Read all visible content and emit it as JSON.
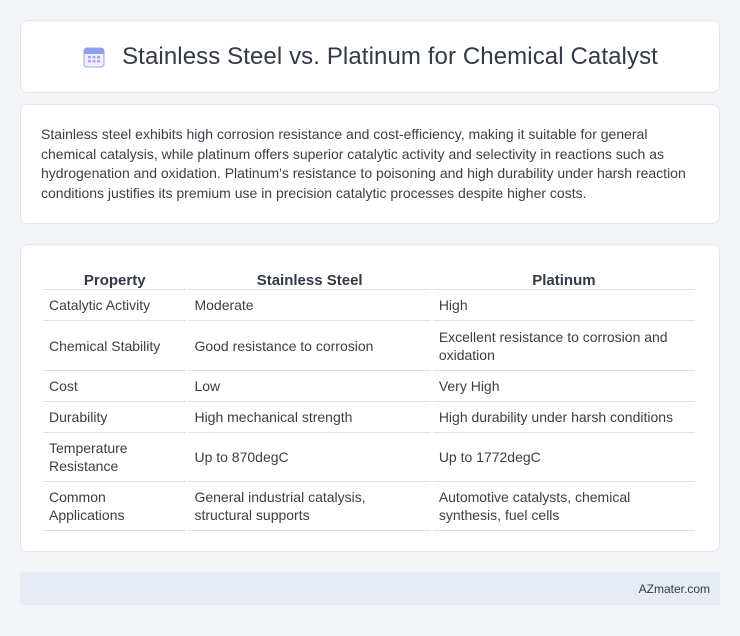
{
  "header": {
    "title": "Stainless Steel vs. Platinum for Chemical Catalyst",
    "icon": "calendar-icon"
  },
  "summary": {
    "text": "Stainless steel exhibits high corrosion resistance and cost-efficiency, making it suitable for general chemical catalysis, while platinum offers superior catalytic activity and selectivity in reactions such as hydrogenation and oxidation. Platinum's resistance to poisoning and high durability under harsh reaction conditions justifies its premium use in precision catalytic processes despite higher costs."
  },
  "table": {
    "headers": [
      "Property",
      "Stainless Steel",
      "Platinum"
    ],
    "rows": [
      [
        "Catalytic Activity",
        "Moderate",
        "High"
      ],
      [
        "Chemical Stability",
        "Good resistance to corrosion",
        "Excellent resistance to corrosion and oxidation"
      ],
      [
        "Cost",
        "Low",
        "Very High"
      ],
      [
        "Durability",
        "High mechanical strength",
        "High durability under harsh conditions"
      ],
      [
        "Temperature Resistance",
        "Up to 870degC",
        "Up to 1772degC"
      ],
      [
        "Common Applications",
        "General industrial catalysis, structural supports",
        "Automotive catalysts, chemical synthesis, fuel cells"
      ]
    ]
  },
  "footer": {
    "text": "AZmater.com"
  },
  "colors": {
    "background": "#f3f5f9",
    "card": "#ffffff",
    "footer": "#e6ebf5",
    "icon_accent": "#7b8ee0"
  }
}
